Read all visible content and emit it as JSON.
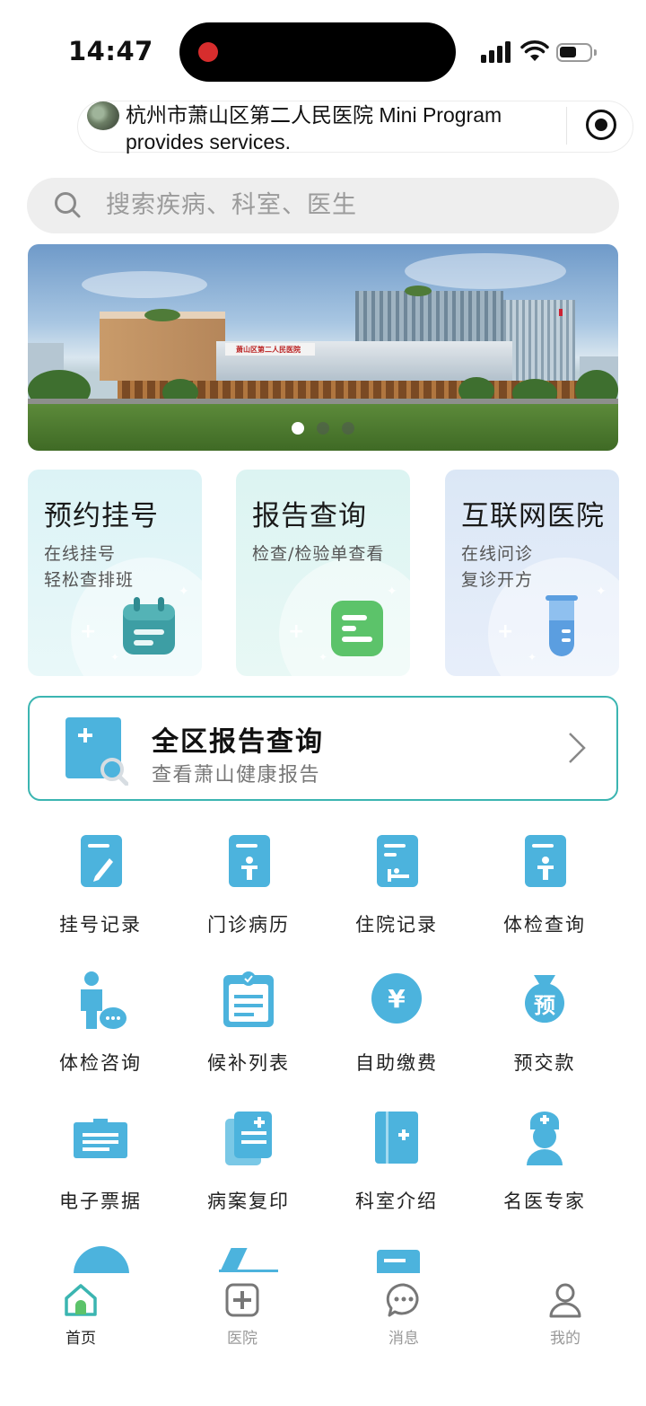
{
  "status_bar": {
    "time": "14:47"
  },
  "mini_program_banner": {
    "text": "杭州市萧山区第二人民医院  Mini Program provides services."
  },
  "search": {
    "placeholder": "搜索疾病、科室、医生"
  },
  "hero": {
    "sign_text": "萧山区第二人民医院",
    "dots_count": 3,
    "active_dot": 0
  },
  "cards": [
    {
      "title": "预约挂号",
      "sub_line1": "在线挂号",
      "sub_line2": "轻松查排班",
      "icon": "calendar-icon"
    },
    {
      "title": "报告查询",
      "sub_line1": "检查/检验单查看",
      "sub_line2": "",
      "icon": "report-doc-icon"
    },
    {
      "title": "互联网医院",
      "sub_line1": "在线问诊",
      "sub_line2": "复诊开方",
      "icon": "test-tube-icon"
    }
  ],
  "district_report": {
    "title": "全区报告查询",
    "subtitle": "查看萧山健康报告"
  },
  "grid": [
    {
      "label": "挂号记录",
      "icon": "registration-record-icon"
    },
    {
      "label": "门诊病历",
      "icon": "outpatient-record-icon"
    },
    {
      "label": "住院记录",
      "icon": "inpatient-record-icon"
    },
    {
      "label": "体检查询",
      "icon": "checkup-query-icon"
    },
    {
      "label": "体检咨询",
      "icon": "checkup-consult-icon"
    },
    {
      "label": "候补列表",
      "icon": "waitlist-icon"
    },
    {
      "label": "自助缴费",
      "icon": "self-payment-icon"
    },
    {
      "label": "预交款",
      "icon": "prepayment-icon"
    },
    {
      "label": "电子票据",
      "icon": "e-invoice-icon"
    },
    {
      "label": "病案复印",
      "icon": "record-copy-icon"
    },
    {
      "label": "科室介绍",
      "icon": "department-intro-icon"
    },
    {
      "label": "名医专家",
      "icon": "expert-doctor-icon"
    }
  ],
  "tabbar": {
    "items": [
      {
        "label": "首页",
        "icon": "home-icon",
        "active": true
      },
      {
        "label": "医院",
        "icon": "hospital-icon",
        "active": false
      },
      {
        "label": "消息",
        "icon": "message-icon",
        "active": false
      },
      {
        "label": "我的",
        "icon": "profile-icon",
        "active": false
      }
    ]
  },
  "colors": {
    "accent": "#3bb5b1",
    "icon_blue": "#4cb3dd",
    "card_green": "#5cc36a"
  }
}
